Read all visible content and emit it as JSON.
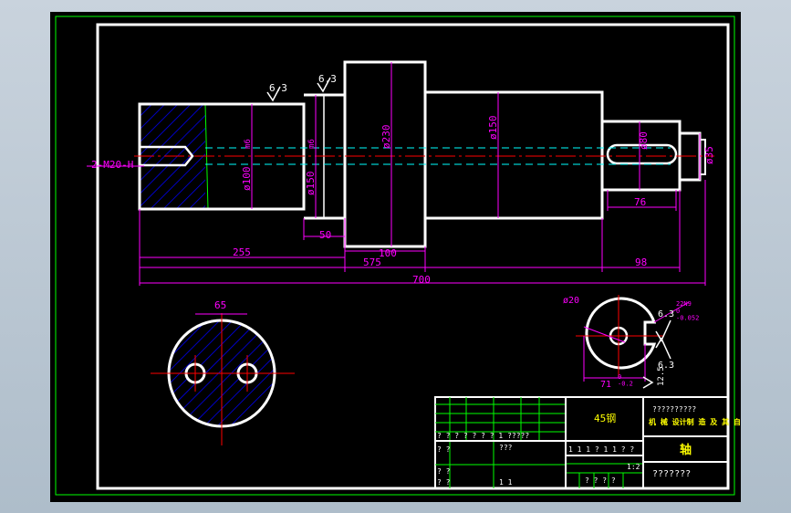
{
  "colors": {
    "background": "#000000",
    "outline": "#ffffff",
    "frame": "#00ff00",
    "dimension": "#ff00ff",
    "centerline": "#ff0000",
    "hidden": "#00ffff",
    "hatch": "#0000ff",
    "note": "#ffff00"
  },
  "drawing": {
    "thread_note": "2-M20-H",
    "roughness": [
      "6.3",
      "6.3",
      "6.3",
      "6.3"
    ],
    "diameters": {
      "d100": "ø100",
      "d100_tol": "m6",
      "d150a": "ø150",
      "d150a_tol": "m6",
      "d230": "ø230",
      "d150b": "ø150",
      "d80": "ø80",
      "d35": "ø35"
    },
    "lengths": {
      "len50": "50",
      "len100": "100",
      "len255": "255",
      "len575": "575",
      "len700": "700",
      "len98": "98",
      "len76": "76"
    },
    "end_view": {
      "width": "65"
    },
    "section": {
      "dia": "ø20",
      "depth": "71",
      "depth_tol": "0\n-0.2",
      "key_width": "22N9",
      "key_width_tol": "0\n-0.052",
      "roughness": [
        "6.3",
        "6.3"
      ],
      "roughness_vert": "12.5"
    }
  },
  "title_block": {
    "material": "45钢",
    "company": "??????????",
    "subtitle": "机 械 设计制 造 及 其 自 动化",
    "part_name": "轴",
    "designer": "???????",
    "row_small_1": "? ? ? ? ? ? ? 1 ?????",
    "row_small_2": "??????",
    "scale_row": "1 1 1 ?  1 1  ? ?",
    "scale": "1:2",
    "sheet_row": "?  ?  ?  ?",
    "left_a": "? ?",
    "left_b": "? ?",
    "left_c": "? ?",
    "mid_a": "???",
    "mid_b": "1 1"
  }
}
